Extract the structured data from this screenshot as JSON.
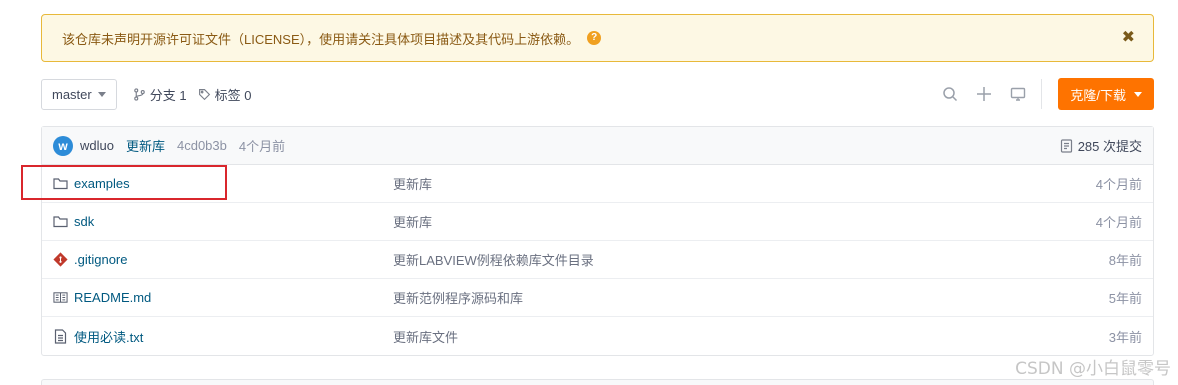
{
  "banner": {
    "text": "该仓库未声明开源许可证文件（LICENSE），使用请关注具体项目描述及其代码上游依赖。",
    "info_icon": "?",
    "close_icon": "✖"
  },
  "toolbar": {
    "branch": "master",
    "branches_label": "分支 1",
    "tags_label": "标签 0",
    "icons": [
      "search-icon",
      "plus-icon",
      "monitor-icon"
    ],
    "clone_label": "克隆/下载"
  },
  "commit": {
    "avatar_letter": "w",
    "author": "wdluo",
    "message": "更新库",
    "sha": "4cd0b3b",
    "time": "4个月前",
    "count_label": "285 次提交"
  },
  "files": [
    {
      "name": "examples",
      "type": "folder",
      "message": "更新库",
      "time": "4个月前"
    },
    {
      "name": "sdk",
      "type": "folder",
      "message": "更新库",
      "time": "4个月前"
    },
    {
      "name": ".gitignore",
      "type": "git",
      "message": "更新LABVIEW例程依赖库文件目录",
      "time": "8年前"
    },
    {
      "name": "README.md",
      "type": "readme",
      "message": "更新范例程序源码和库",
      "time": "5年前"
    },
    {
      "name": "使用必读.txt",
      "type": "text",
      "message": "更新库文件",
      "time": "3年前"
    }
  ],
  "watermark": "CSDN @小白鼠零号",
  "colors": {
    "accent_orange": "#fe7300",
    "link_blue": "#005980",
    "banner_bg": "#fdf8e4",
    "banner_border": "#e8b93a",
    "highlight_red": "#d9262c"
  }
}
